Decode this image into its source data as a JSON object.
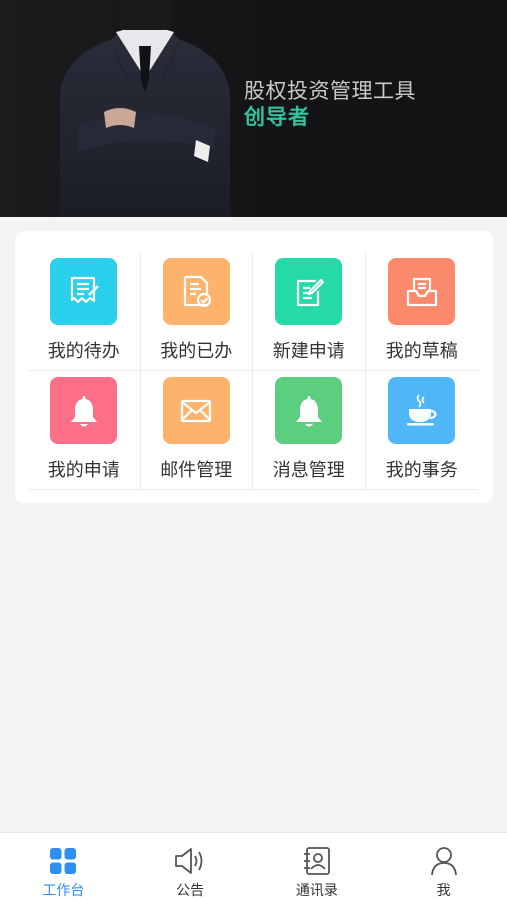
{
  "banner": {
    "title": "股权投资管理工具",
    "subtitle": "创导者"
  },
  "grid": {
    "items": [
      {
        "label": "我的待办",
        "icon": "todo-icon",
        "color": "#2ad0ec"
      },
      {
        "label": "我的已办",
        "icon": "done-icon",
        "color": "#fdb36b"
      },
      {
        "label": "新建申请",
        "icon": "new-request-icon",
        "color": "#25d9a8"
      },
      {
        "label": "我的草稿",
        "icon": "draft-icon",
        "color": "#fb8a6c"
      },
      {
        "label": "我的申请",
        "icon": "bell-icon",
        "color": "#fc6f86"
      },
      {
        "label": "邮件管理",
        "icon": "mail-icon",
        "color": "#fdb36b"
      },
      {
        "label": "消息管理",
        "icon": "bell-icon",
        "color": "#5ccf7e"
      },
      {
        "label": "我的事务",
        "icon": "coffee-icon",
        "color": "#4fb7f8"
      }
    ]
  },
  "tabbar": {
    "tabs": [
      {
        "label": "工作台",
        "icon": "grid-icon",
        "active": true
      },
      {
        "label": "公告",
        "icon": "speaker-icon",
        "active": false
      },
      {
        "label": "通讯录",
        "icon": "contacts-icon",
        "active": false
      },
      {
        "label": "我",
        "icon": "user-icon",
        "active": false
      }
    ],
    "active_color": "#2e8ff0"
  }
}
